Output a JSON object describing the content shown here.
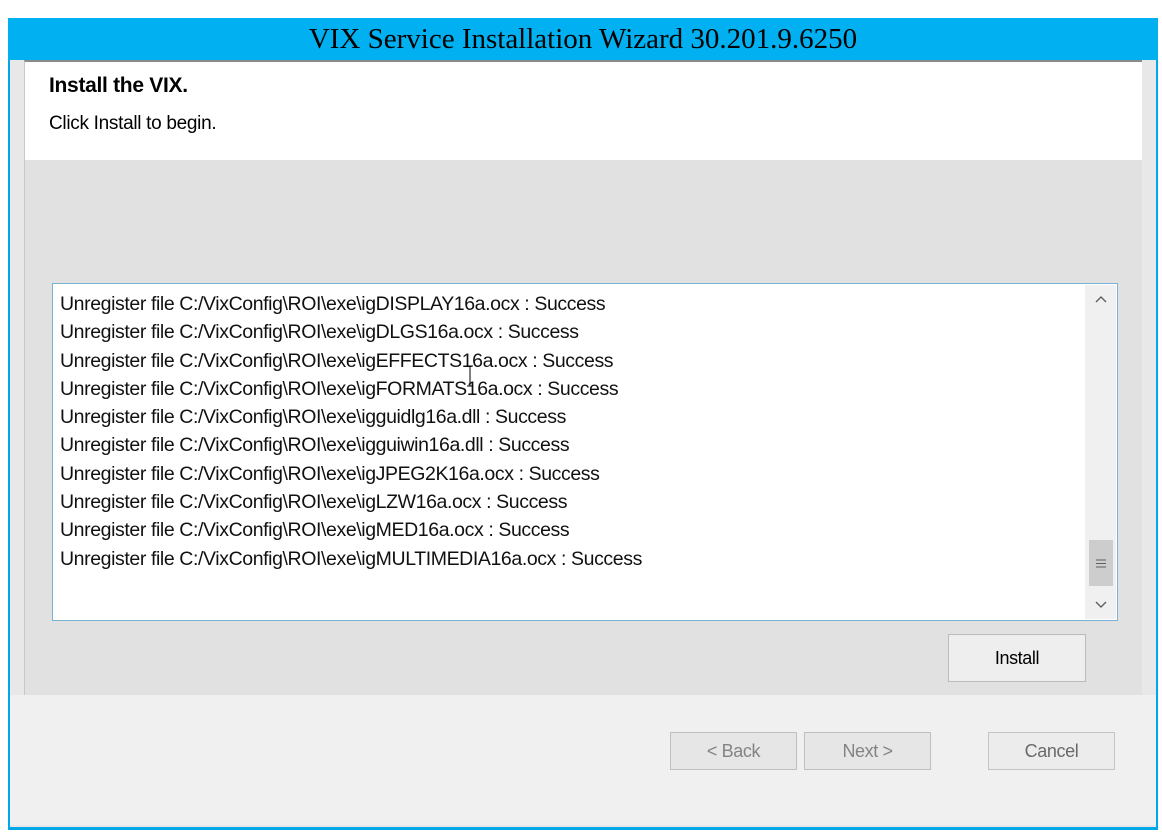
{
  "window": {
    "title": "VIX Service Installation Wizard 30.201.9.6250",
    "accent_color": "#00b0f0"
  },
  "header": {
    "title": "Install the VIX.",
    "subtitle": "Click Install to begin."
  },
  "log": {
    "lines": [
      "Unregister file C:/VixConfig\\ROI\\exe\\igDISPLAY16a.ocx : Success",
      "Unregister file C:/VixConfig\\ROI\\exe\\igDLGS16a.ocx : Success",
      "Unregister file C:/VixConfig\\ROI\\exe\\igEFFECTS16a.ocx : Success",
      "Unregister file C:/VixConfig\\ROI\\exe\\igFORMATS16a.ocx : Success",
      "Unregister file C:/VixConfig\\ROI\\exe\\igguidlg16a.dll : Success",
      "Unregister file C:/VixConfig\\ROI\\exe\\igguiwin16a.dll : Success",
      "Unregister file C:/VixConfig\\ROI\\exe\\igJPEG2K16a.ocx : Success",
      "Unregister file C:/VixConfig\\ROI\\exe\\igLZW16a.ocx : Success",
      "Unregister file C:/VixConfig\\ROI\\exe\\igMED16a.ocx : Success",
      "Unregister file C:/VixConfig\\ROI\\exe\\igMULTIMEDIA16a.ocx : Success"
    ],
    "scroll_up_icon": "chevron-up-icon",
    "scroll_down_icon": "chevron-down-icon",
    "scroll_thumb_icon": "grip-icon"
  },
  "buttons": {
    "install": "Install",
    "back": "< Back",
    "next": "Next >",
    "cancel": "Cancel"
  },
  "states": {
    "back_enabled": false,
    "next_enabled": false,
    "cancel_enabled": true
  }
}
